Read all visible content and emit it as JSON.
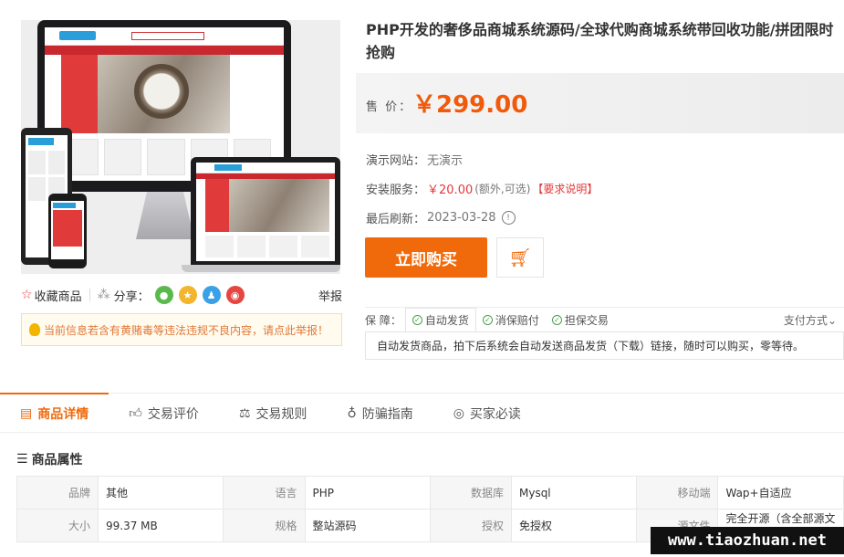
{
  "product": {
    "title": "PHP开发的奢侈品商城系统源码/全球代购商城系统带回收功能/拼团限时抢购",
    "price_label": "售 价：",
    "price": "￥299.00",
    "demo_label": "演示网站：",
    "demo_value": "无演示",
    "install_label": "安装服务：",
    "install_price": "￥20.00",
    "install_note": "(额外,可选)",
    "install_link": "【要求说明】",
    "refresh_label": "最后刷新：",
    "refresh_date": "2023-03-28",
    "buy_label": "立即购买",
    "cart_icon": "cart-icon"
  },
  "share": {
    "fav_label": "收藏商品",
    "share_label": "分享：",
    "report_label": "举报"
  },
  "notice": "当前信息若含有黄赌毒等违法违规不良内容，请点此举报！",
  "guarantee": {
    "label": "保 障：",
    "tabs": [
      "自动发货",
      "消保赔付",
      "担保交易"
    ],
    "payment_label": "支付方式",
    "description": "自动发货商品，拍下后系统会自动发送商品发货（下载）链接，随时可以购买，零等待。"
  },
  "tabs": [
    {
      "label": "商品详情",
      "icon": "document-icon"
    },
    {
      "label": "交易评价",
      "icon": "thumbs-up-icon"
    },
    {
      "label": "交易规则",
      "icon": "scale-icon"
    },
    {
      "label": "防骗指南",
      "icon": "bulb-icon"
    },
    {
      "label": "买家必读",
      "icon": "target-icon"
    }
  ],
  "attributes": {
    "title": "商品属性",
    "rows": [
      [
        [
          "品牌",
          "其他"
        ],
        [
          "语言",
          "PHP"
        ],
        [
          "数据库",
          "Mysql"
        ],
        [
          "移动端",
          "Wap+自适应"
        ]
      ],
      [
        [
          "大小",
          "99.37 MB"
        ],
        [
          "规格",
          "整站源码"
        ],
        [
          "授权",
          "免授权"
        ],
        [
          "源文件",
          "完全开源（含全部源文件）"
        ]
      ]
    ]
  },
  "watermark": "www.tiaozhuan.net",
  "colors": {
    "accent": "#f06a0c",
    "red": "#e4393c",
    "green": "#4aa14a"
  }
}
